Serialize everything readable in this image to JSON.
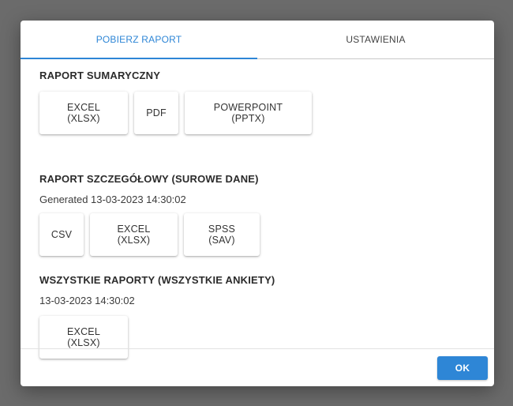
{
  "tabs": [
    {
      "label": "POBIERZ RAPORT",
      "active": true
    },
    {
      "label": "USTAWIENIA",
      "active": false
    }
  ],
  "sections": [
    {
      "title": "RAPORT SUMARYCZNY",
      "buttons": [
        "EXCEL (XLSX)",
        "PDF",
        "POWERPOINT (PPTX)"
      ]
    },
    {
      "title": "RAPORT SZCZEGÓŁOWY (SUROWE DANE)",
      "meta": "Generated 13-03-2023 14:30:02",
      "buttons": [
        "CSV",
        "EXCEL (XLSX)",
        "SPSS (SAV)"
      ]
    },
    {
      "title": "WSZYSTKIE RAPORTY (WSZYSTKIE ANKIETY)",
      "meta": "13-03-2023 14:30:02",
      "buttons": [
        "EXCEL (XLSX)"
      ]
    }
  ],
  "footer": {
    "ok_label": "OK"
  },
  "colors": {
    "accent": "#2e86d6",
    "overlay": "#6b6b6b"
  }
}
